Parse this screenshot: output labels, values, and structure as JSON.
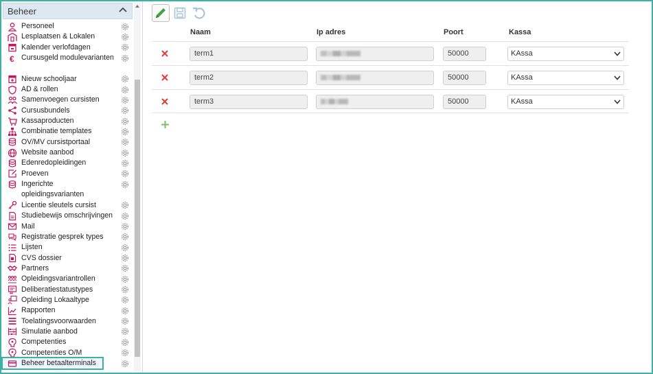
{
  "sidebar": {
    "title": "Beheer",
    "items": [
      {
        "label": "Personeel",
        "icon": "person-icon"
      },
      {
        "label": "Lesplaatsen & Lokalen",
        "icon": "building-icon"
      },
      {
        "label": "Kalender verlofdagen",
        "icon": "calendar-icon"
      },
      {
        "label": "Cursusgeld modulevarianten",
        "icon": "euro-icon"
      },
      {
        "label": "Nieuw schooljaar",
        "icon": "calendar-plus-icon"
      },
      {
        "label": "AD & rollen",
        "icon": "shield-icon"
      },
      {
        "label": "Samenvoegen cursisten",
        "icon": "users-merge-icon"
      },
      {
        "label": "Cursusbundels",
        "icon": "share-nodes-icon"
      },
      {
        "label": "Kassaproducten",
        "icon": "cart-icon"
      },
      {
        "label": "Combinatie templates",
        "icon": "sitemap-icon"
      },
      {
        "label": "OV/MV cursistportaal",
        "icon": "database-icon"
      },
      {
        "label": "Website aanbod",
        "icon": "globe-icon"
      },
      {
        "label": "Edenredopleidingen",
        "icon": "database-icon"
      },
      {
        "label": "Proeven",
        "icon": "edit-doc-icon"
      },
      {
        "label": "Ingerichte opleidingsvarianten",
        "icon": "database-icon"
      },
      {
        "label": "Licentie sleutels cursist",
        "icon": "key-icon"
      },
      {
        "label": "Studiebewijs omschrijvingen",
        "icon": "document-icon"
      },
      {
        "label": "Mail",
        "icon": "envelope-icon"
      },
      {
        "label": "Registratie gesprek types",
        "icon": "chat-icon"
      },
      {
        "label": "Lijsten",
        "icon": "list-icon"
      },
      {
        "label": "CVS dossier",
        "icon": "file-icon"
      },
      {
        "label": "Partners",
        "icon": "handshake-icon"
      },
      {
        "label": "Opleidingsvariantrollen",
        "icon": "group-icon"
      },
      {
        "label": "Deliberatiestatustypes",
        "icon": "certificate-icon"
      },
      {
        "label": "Opleiding Lokaaltype",
        "icon": "person-board-icon"
      },
      {
        "label": "Rapporten",
        "icon": "chart-line-icon"
      },
      {
        "label": "Toelatingsvoorwaarden",
        "icon": "bars-icon"
      },
      {
        "label": "Simulatie aanbod",
        "icon": "abacus-icon"
      },
      {
        "label": "Competenties",
        "icon": "head-icon"
      },
      {
        "label": "Competenties O/M",
        "icon": "head-icon"
      },
      {
        "label": "Beheer betaalterminals",
        "icon": "card-icon"
      }
    ]
  },
  "table": {
    "headers": {
      "naam": "Naam",
      "ip": "Ip adres",
      "poort": "Poort",
      "kassa": "Kassa"
    },
    "rows": [
      {
        "naam": "term1",
        "poort": "50000",
        "kassa": "KAssa"
      },
      {
        "naam": "term2",
        "poort": "50000",
        "kassa": "KAssa"
      },
      {
        "naam": "term3",
        "poort": "50000",
        "kassa": "KAssa"
      }
    ]
  },
  "colors": {
    "accent": "#3fb0a6",
    "brand_pink": "#c2185b",
    "delete_red": "#e53935",
    "add_green": "#7cbf6a",
    "edit_green": "#43a047"
  }
}
